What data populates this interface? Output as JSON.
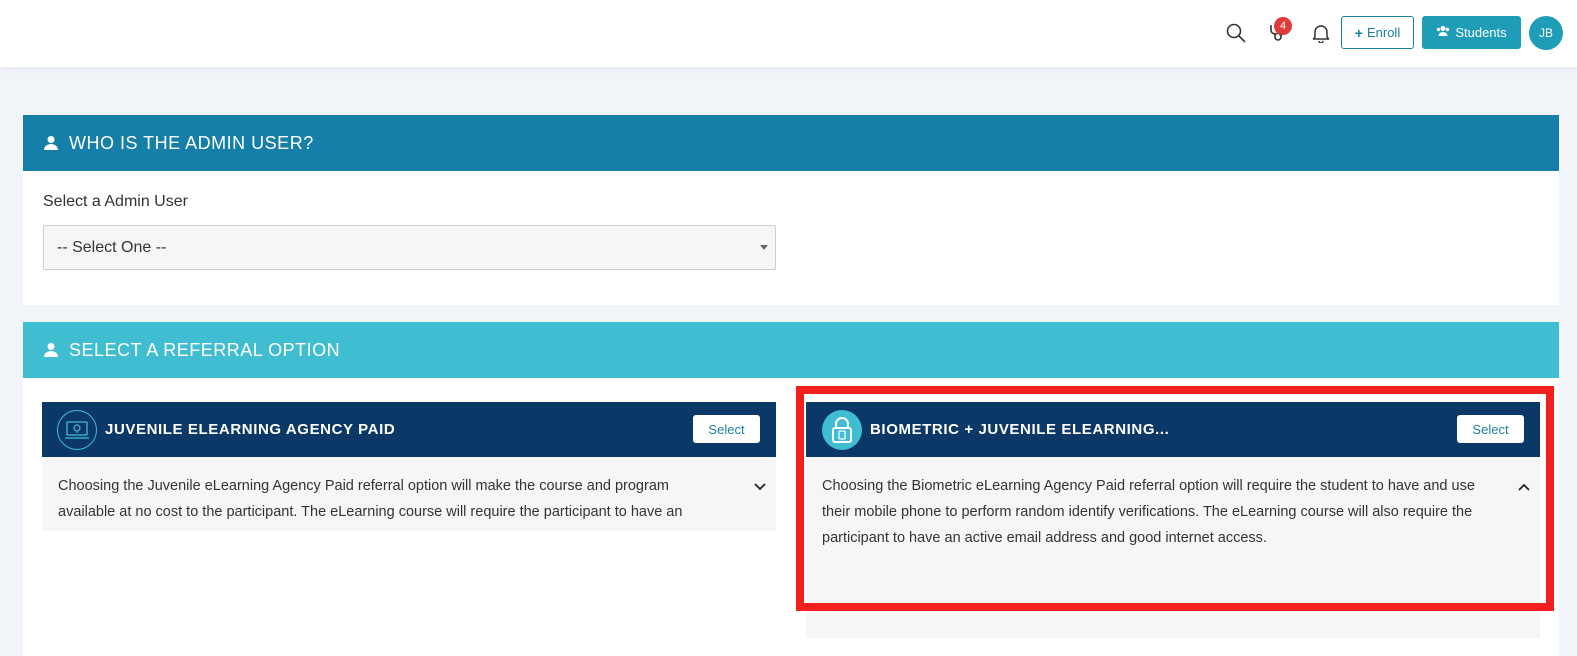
{
  "topbar": {
    "notification_count": "4",
    "enroll_label": "Enroll",
    "students_label": "Students",
    "avatar_initials": "JB"
  },
  "admin_panel": {
    "title": "WHO IS THE ADMIN USER?",
    "select_label": "Select a Admin User",
    "select_value": "-- Select One --"
  },
  "referral_panel": {
    "title": "SELECT A REFERRAL OPTION",
    "options": [
      {
        "title": "JUVENILE ELEARNING AGENCY PAID",
        "select_label": "Select",
        "description": "Choosing the Juvenile eLearning Agency Paid referral option will make the course and program available at no cost to the participant. The eLearning course will require the participant to have an active email"
      },
      {
        "title": "BIOMETRIC + JUVENILE ELEARNING...",
        "select_label": "Select",
        "description": "Choosing the Biometric eLearning Agency Paid referral option will require the student to have and use their mobile phone to perform random identify verifications. The eLearning course will also require the participant to have an active email address and good internet access."
      }
    ]
  },
  "colors": {
    "admin_header": "#157fa9",
    "referral_header": "#40bdd1",
    "card_header": "#0b3866",
    "accent": "#1f9db6",
    "highlight": "#f21f1f"
  }
}
